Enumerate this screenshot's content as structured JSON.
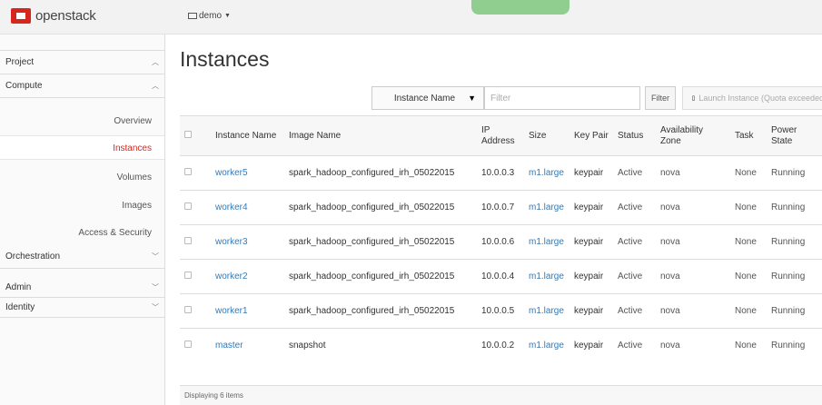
{
  "app": {
    "logo_text": "openstack",
    "project_label": "demo",
    "brand_color": "#d6261e",
    "link_color": "#337ab7"
  },
  "sidebar": {
    "project": "Project",
    "compute": "Compute",
    "items": [
      "Overview",
      "Instances",
      "Volumes",
      "Images",
      "Access & Security"
    ],
    "active_item": "Instances",
    "orchestration": "Orchestration",
    "admin": "Admin",
    "identity": "Identity"
  },
  "main": {
    "title": "Instances",
    "filter_field": "Instance Name",
    "filter_placeholder": "Filter",
    "filter_button": "Filter",
    "launch_button": "Launch Instance (Quota exceeded)"
  },
  "table": {
    "headers": [
      "Instance Name",
      "Image Name",
      "IP Address",
      "Size",
      "Key Pair",
      "Status",
      "Availability Zone",
      "Task",
      "Power State"
    ],
    "rows": [
      [
        "worker5",
        "spark_hadoop_configured_irh_05022015",
        "10.0.0.3",
        "m1.large",
        "keypair",
        "Active",
        "nova",
        "None",
        "Running"
      ],
      [
        "worker4",
        "spark_hadoop_configured_irh_05022015",
        "10.0.0.7",
        "m1.large",
        "keypair",
        "Active",
        "nova",
        "None",
        "Running"
      ],
      [
        "worker3",
        "spark_hadoop_configured_irh_05022015",
        "10.0.0.6",
        "m1.large",
        "keypair",
        "Active",
        "nova",
        "None",
        "Running"
      ],
      [
        "worker2",
        "spark_hadoop_configured_irh_05022015",
        "10.0.0.4",
        "m1.large",
        "keypair",
        "Active",
        "nova",
        "None",
        "Running"
      ],
      [
        "worker1",
        "spark_hadoop_configured_irh_05022015",
        "10.0.0.5",
        "m1.large",
        "keypair",
        "Active",
        "nova",
        "None",
        "Running"
      ],
      [
        "master",
        "snapshot",
        "10.0.0.2",
        "m1.large",
        "keypair",
        "Active",
        "nova",
        "None",
        "Running"
      ]
    ],
    "footer": "Displaying 6 items"
  }
}
